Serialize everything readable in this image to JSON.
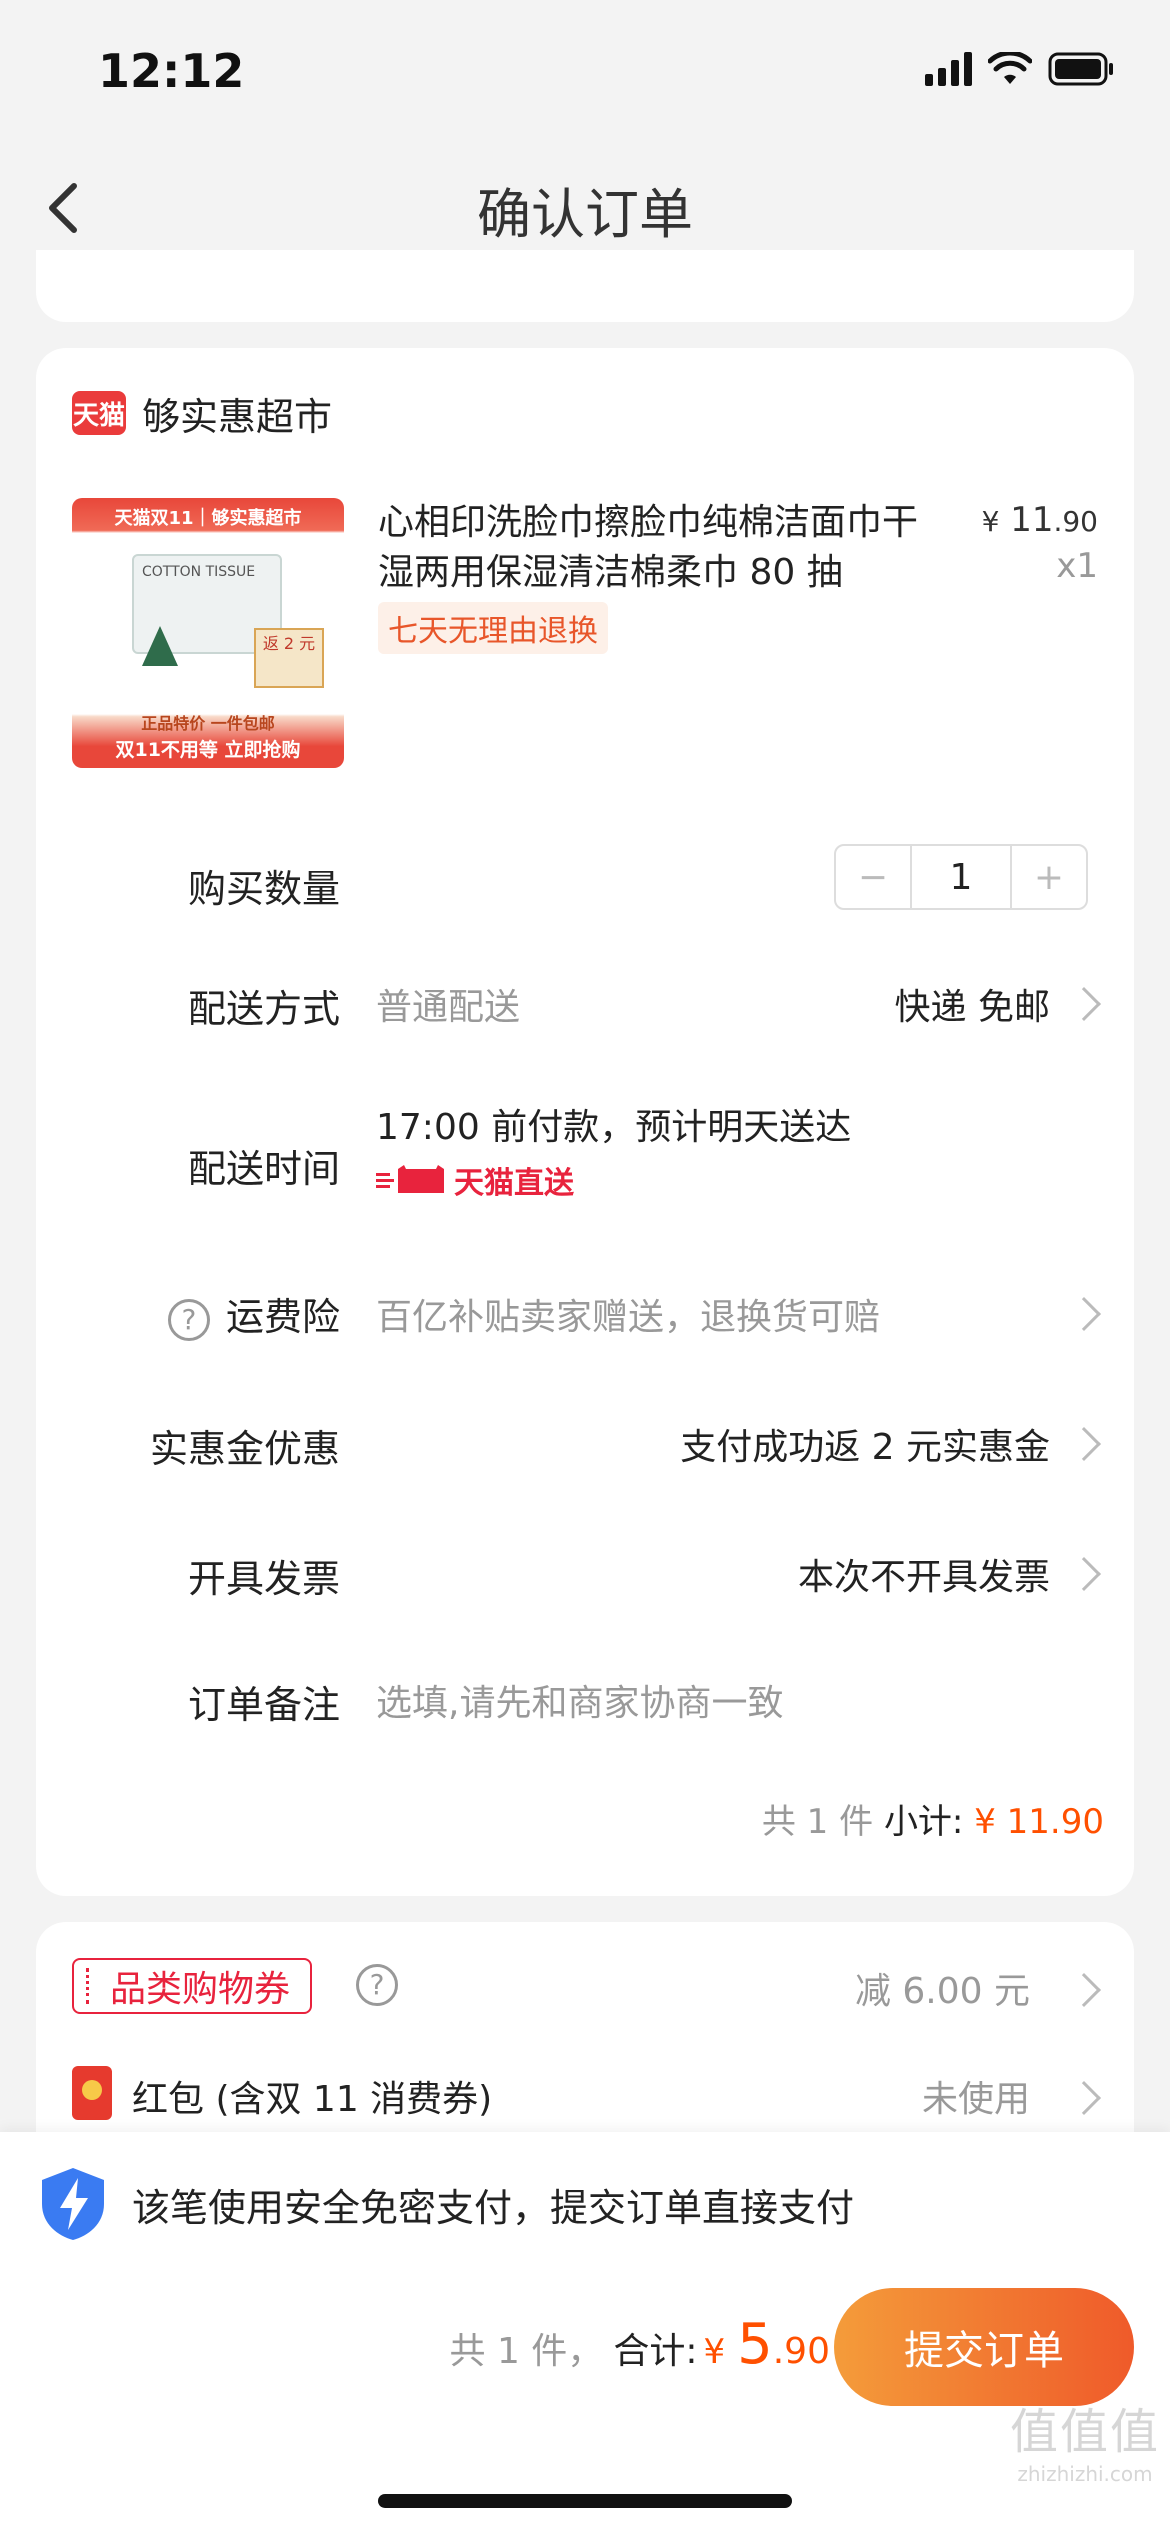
{
  "status_bar": {
    "time": "12:12"
  },
  "nav": {
    "title": "确认订单"
  },
  "store": {
    "badge": "天猫",
    "name": "够实惠超市"
  },
  "product": {
    "thumb_top": "天猫双11｜够实惠超市",
    "thumb_cotton": "COTTON TISSUE",
    "thumb_price": "返 2 元",
    "thumb_line1": "正品特价 一件包邮",
    "thumb_line2": "双11不用等 立即抢购",
    "title": "心相印洗脸巾擦脸巾纯棉洁面巾干湿两用保湿清洁棉柔巾 80 抽",
    "price_symbol": "¥",
    "price_int": "11",
    "price_dec": ".90",
    "quantity_label": "x1",
    "return_tag": "七天无理由退换"
  },
  "rows": {
    "quantity": {
      "label": "购买数量",
      "minus": "−",
      "value": "1",
      "plus": "+"
    },
    "delivery": {
      "label": "配送方式",
      "value": "普通配送",
      "right": "快递 免邮"
    },
    "delivery_time": {
      "label": "配送时间",
      "value": "17:00 前付款，预计明天送达",
      "tag": "天猫直送"
    },
    "shipping_insurance": {
      "label": "运费险",
      "value": "百亿补贴卖家赠送，退换货可赔"
    },
    "discount": {
      "label": "实惠金优惠",
      "value": "支付成功返 2 元实惠金"
    },
    "invoice": {
      "label": "开具发票",
      "value": "本次不开具发票"
    },
    "note": {
      "label": "订单备注",
      "placeholder": "选填,请先和商家协商一致"
    }
  },
  "subtotal": {
    "count": "共 1 件",
    "label": "小计:",
    "amount": "¥ 11.90"
  },
  "coupons": {
    "category": {
      "label": "品类购物券",
      "value": "减 6.00 元"
    },
    "redpacket": {
      "label": "红包 (含双 11 消费券)",
      "value": "未使用"
    }
  },
  "bottom": {
    "secure_text": "该笔使用安全免密支付，提交订单直接支付",
    "count": "共 1 件，",
    "total_label": "合计:",
    "currency": "¥",
    "total_int": "5",
    "total_dec": ".90",
    "submit": "提交订单"
  },
  "watermark": {
    "logo": "值值值",
    "url": "zhizhizhi.com"
  }
}
